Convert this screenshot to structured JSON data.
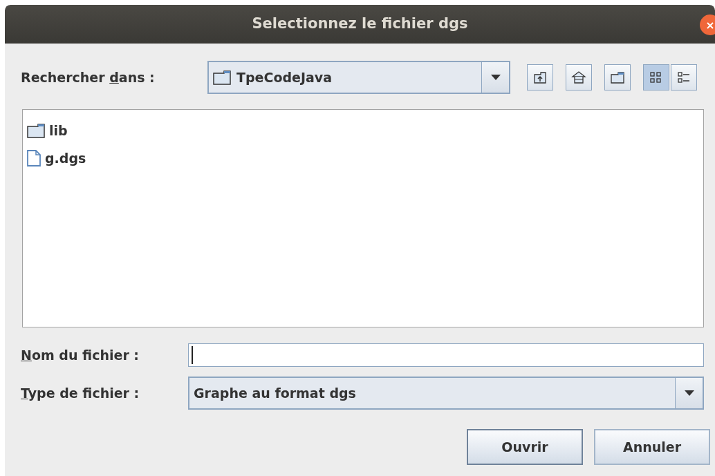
{
  "window": {
    "title": "Selectionnez le fichier dgs"
  },
  "look_in": {
    "label": {
      "before": "Rechercher ",
      "key": "d",
      "after": "ans :"
    },
    "value": "TpeCodeJava"
  },
  "toolbar": [
    {
      "kind": "up",
      "selected": false
    },
    {
      "kind": "home",
      "selected": false
    },
    {
      "kind": "new-folder",
      "selected": false
    },
    {
      "kind": "list",
      "selected": true
    },
    {
      "kind": "details",
      "selected": false
    }
  ],
  "files": [
    {
      "name": "lib",
      "kind": "folder",
      "selected": false
    },
    {
      "name": "g.dgs",
      "kind": "file",
      "selected": false
    }
  ],
  "file_name": {
    "label": {
      "key": "N",
      "after": "om du fichier :"
    }
  },
  "file_type": {
    "label": {
      "key": "T",
      "after": "ype de fichier :"
    },
    "value": "Graphe au format dgs"
  },
  "buttons": [
    {
      "label": "Ouvrir",
      "default": true
    },
    {
      "label": "Annuler",
      "default": false
    }
  ]
}
